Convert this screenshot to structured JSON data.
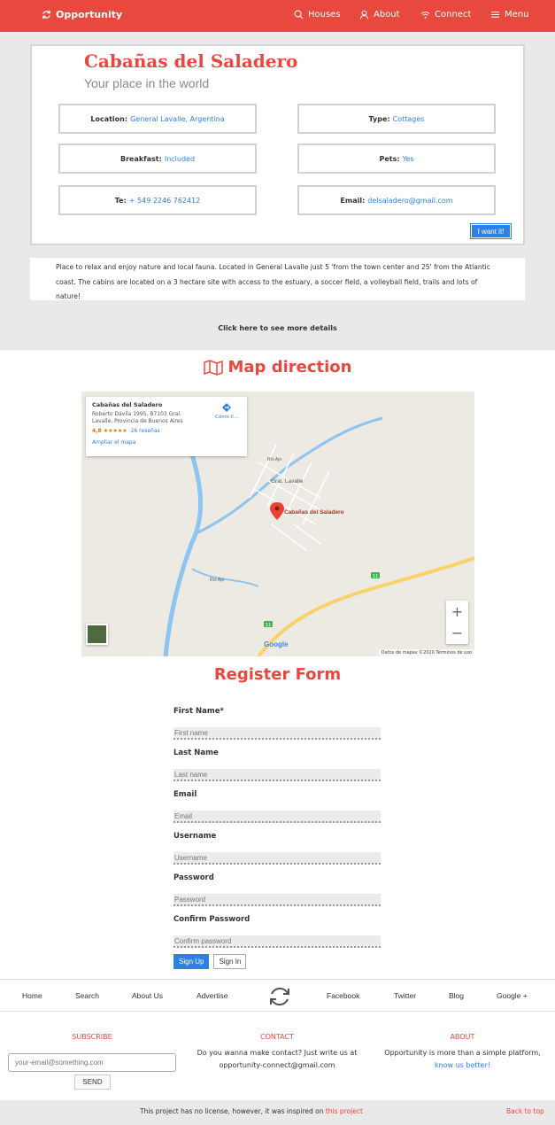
{
  "header": {
    "brand": "Opportunity",
    "nav": [
      {
        "label": "Houses",
        "icon": "search-icon"
      },
      {
        "label": "About",
        "icon": "user-icon"
      },
      {
        "label": "Connect",
        "icon": "wifi-icon"
      },
      {
        "label": "Menu",
        "icon": "menu-icon"
      }
    ],
    "accent": "#e8483d"
  },
  "listing": {
    "title": "Cabañas del Saladero",
    "subtitle": "Your place in the world",
    "location_key": "Location:",
    "location_value": "General Lavalle, Argentina",
    "type_key": "Type:",
    "type_value": "Cottages",
    "breakfast_key": "Breakfast:",
    "breakfast_value": "Included",
    "pets_key": "Pets:",
    "pets_value": "Yes",
    "tel_key": "Te:",
    "tel_value": "+ 549 2246 762412",
    "email_key": "Email:",
    "email_value": "delsaladero@gmail.com",
    "want_button": "I want it!",
    "description": "Place to relax and enjoy nature and local fauna. Located in General Lavalle just 5 'from the town center and 25' from the Atlantic coast. The cabins are located on a 3 hectare site with access to the estuary, a soccer field, a volleyball field, trails and lots of nature!",
    "more_link": "Click here to see more details"
  },
  "map_section": {
    "title": "Map direction",
    "card_name": "Cabañas del Saladero",
    "card_address_1": "Roberto Dávila 1995, B7103 Gral.",
    "card_address_2": "Lavalle, Provincia de Buenos Aires",
    "card_rating": "4,8 ★★★★★",
    "card_reviews": "26 reseñas",
    "card_link": "Ampliar el mapa",
    "card_directions": "Cómo ll...",
    "town_label": "Gral. Lavalle",
    "marker_label": "Cabañas del Saladero",
    "river_label_1": "Río Ajo",
    "river_label_2": "Río Ajo",
    "route_label": "11",
    "route_label_2": "11",
    "footer_text": "Datos de mapas ©2020    Términos de uso",
    "google": "Google"
  },
  "register": {
    "title": "Register Form",
    "fields": [
      {
        "label": "First Name*",
        "placeholder": "First name"
      },
      {
        "label": "Last Name",
        "placeholder": "Last name"
      },
      {
        "label": "Email",
        "placeholder": "Email"
      },
      {
        "label": "Username",
        "placeholder": "Username"
      },
      {
        "label": "Password",
        "placeholder": "Password"
      },
      {
        "label": "Confirm Password",
        "placeholder": "Confirm password"
      }
    ],
    "signup": "Sign Up",
    "signin": "Sign In"
  },
  "footer_nav": {
    "left": [
      "Home",
      "Search",
      "About Us",
      "Advertise"
    ],
    "right": [
      "Facebook",
      "Twitter",
      "Blog",
      "Google +"
    ]
  },
  "footer": {
    "subscribe_title": "SUBSCRIBE",
    "subscribe_placeholder": "your-email@something.com",
    "send": "SEND",
    "contact_title": "CONTACT",
    "contact_text_1": "Do you wanna make contact? Just write us at",
    "contact_text_2": "opportunity-connect@gmail.com",
    "about_title": "ABOUT",
    "about_text_1": "Opportunity is more than a simple platform,",
    "about_text_2": "know us better!",
    "license_text": "This project has no license, however, it was inspired on ",
    "license_link": "this project",
    "back_to_top": "Back to top"
  }
}
